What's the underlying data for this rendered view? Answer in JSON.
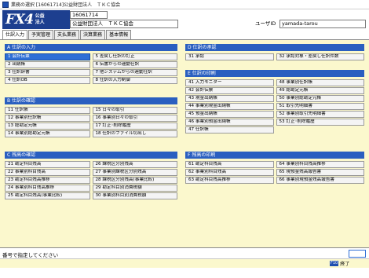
{
  "window": {
    "title": "業務の選択 [16061714]公益財団法人　ＴＫＣ協会"
  },
  "logo": {
    "text": "FX4",
    "sub1": "公益",
    "sub2": "法人"
  },
  "header": {
    "code": "16061714",
    "org_name": "公益財団法人　ＴＫＣ協会",
    "user_label": "ユーザID",
    "user_id": "yamada-tarou"
  },
  "tabs": [
    {
      "label": "仕訳入力"
    },
    {
      "label": "予実管理"
    },
    {
      "label": "支払業務"
    },
    {
      "label": "決算業務"
    },
    {
      "label": "基本情報"
    }
  ],
  "sections": {
    "a": {
      "title": "A 仕訳の入力",
      "items": [
        "1 会計伝票",
        "5 差戻し仕訳の訂正",
        "2 出納帳",
        "6 伝書からの連動仕訳",
        "3 仕訳辞書",
        "7 他システムからの連動仕訳",
        "4 仕訳OB",
        "8 仕訳の入力制御"
      ]
    },
    "b": {
      "title": "B 仕訳の確認",
      "items": [
        "11 仕訳帳",
        "15 日々の取引",
        "12 事業別仕訳帳",
        "16 事業別日々の取引",
        "13 総勘定元帳",
        "17 訂正･削除履歴",
        "14 事業別総勘定元帳",
        "18 仕訳のファイル切出し"
      ]
    },
    "c": {
      "title": "C 残高の確認",
      "items": [
        "21 勘定科目残高",
        "26 課税区分別残高",
        "22 事業別科目残高",
        "27 事業別課税区分別残高",
        "23 勘定科目残高推移",
        "28 課税区分別残高(事業比較)",
        "24 事業別科目残高推移",
        "29 勘定科目別消費税額",
        "25 勘定科目残高(事業比較)",
        "30 事業別科目別消費税額"
      ]
    },
    "d": {
      "title": "D 仕訳の承認",
      "items": [
        "31 承認",
        "32 承認対象・差戻し仕訳件数"
      ]
    },
    "e": {
      "title": "E 仕訳の印刷",
      "items": [
        "41 入力モニター",
        "48 事業別仕訳帳",
        "42 会計伝票",
        "49 総勘定元帳",
        "43 現金出納帳",
        "50 事業別総勘定元帳",
        "44 事業別現金出納帳",
        "51 取引先明細書",
        "45 預金出納帳",
        "52 事業別取引先明細書",
        "46 事業別預金出納帳",
        "53 訂正･削除履歴",
        "47 仕訳帳",
        ""
      ]
    },
    "f": {
      "title": "F 残高の印刷",
      "items": [
        "61 勘定科目残高",
        "64 事業別科目残高推移",
        "62 事業別科目残高",
        "65 現預金残高報告書",
        "63 勘定科目残高推移",
        "66 事業別現預金残高報告書"
      ]
    }
  },
  "status": {
    "prompt": "番号で指定してください",
    "end_key": "F10",
    "end_label": "終了"
  }
}
